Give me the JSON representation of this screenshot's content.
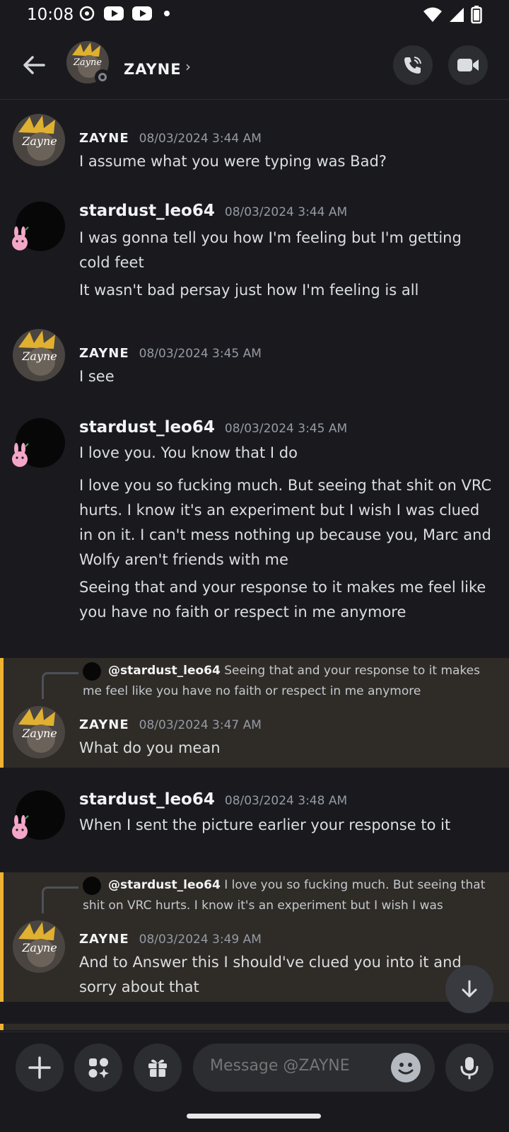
{
  "status_bar": {
    "time": "10:08"
  },
  "header": {
    "title": "ZAYNE",
    "chevron": "›"
  },
  "messages": [
    {
      "author": "ZAYNE",
      "timestamp": "08/03/2024 3:44 AM",
      "lines": [
        "I assume what you were typing was Bad?"
      ]
    },
    {
      "author": "stardust_leo64",
      "timestamp": "08/03/2024 3:44 AM",
      "lines": [
        "I was gonna tell you how I'm feeling but I'm getting cold feet",
        "It wasn't bad persay just how I'm feeling is all"
      ]
    },
    {
      "author": "ZAYNE",
      "timestamp": "08/03/2024 3:45 AM",
      "lines": [
        "I see"
      ]
    },
    {
      "author": "stardust_leo64",
      "timestamp": "08/03/2024 3:45 AM",
      "lines": [
        "I love you. You know that I do",
        "I love you so fucking much. But seeing that shit on VRC hurts. I know it's an experiment but I wish I was clued in on it. I can't mess nothing up because you, Marc and Wolfy aren't friends with me",
        "Seeing that and your response to it makes me feel like you have no faith or respect in me anymore"
      ]
    },
    {
      "reply_user": "@stardust_leo64",
      "reply_text": "Seeing that and your response to it makes me feel like you have no faith or respect in me anymore",
      "author": "ZAYNE",
      "timestamp": "08/03/2024 3:47 AM",
      "lines": [
        "What do you mean"
      ]
    },
    {
      "author": "stardust_leo64",
      "timestamp": "08/03/2024 3:48 AM",
      "lines": [
        "When I sent the picture earlier your response to it"
      ]
    },
    {
      "reply_user": "@stardust_leo64",
      "reply_text": "I love you so fucking much. But seeing that shit on VRC hurts. I know it's an experiment but I wish I was",
      "author": "ZAYNE",
      "timestamp": "08/03/2024 3:49 AM",
      "lines": [
        "And to Answer this I should've clued you into it and sorry about that"
      ]
    }
  ],
  "composer": {
    "placeholder": "Message @ZAYNE"
  },
  "colors": {
    "accent_highlight": "#f0b232",
    "background": "#1a1a1e",
    "button": "#2b2d31"
  },
  "icons": [
    "back-arrow-icon",
    "phone-icon",
    "video-camera-icon",
    "plus-icon",
    "apps-icon",
    "gift-icon",
    "emoji-icon",
    "microphone-icon",
    "arrow-down-icon"
  ]
}
